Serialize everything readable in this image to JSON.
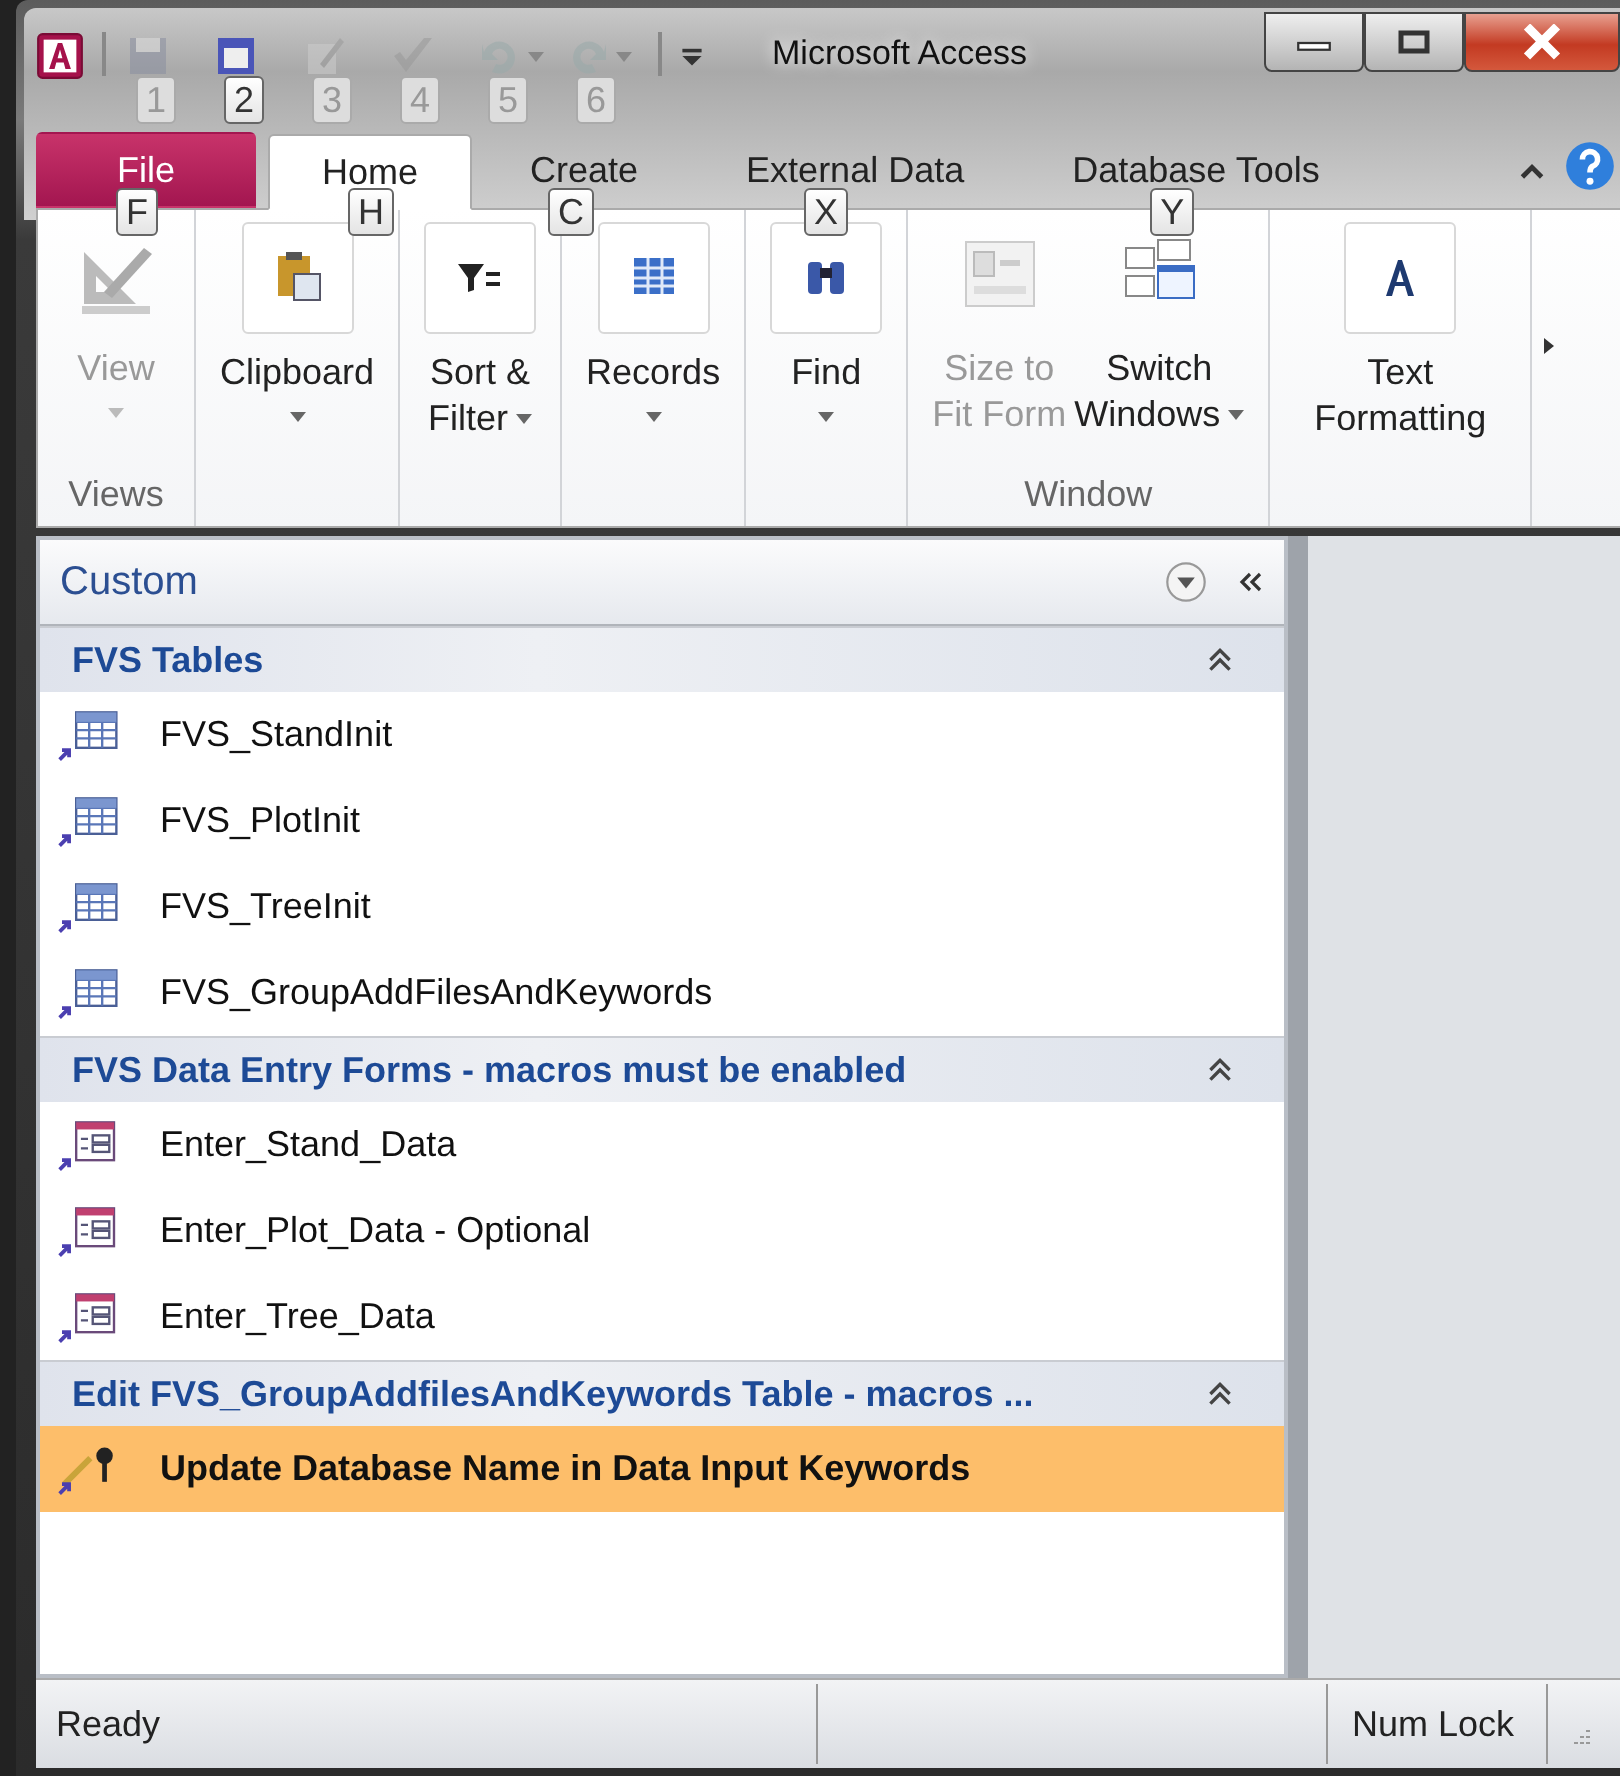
{
  "window": {
    "title": "Microsoft Access"
  },
  "quick_access": [
    {
      "kind": "save",
      "keytip": "1",
      "disabled": true
    },
    {
      "kind": "form",
      "keytip": "2",
      "disabled": false
    },
    {
      "kind": "edit",
      "keytip": "3",
      "disabled": true
    },
    {
      "kind": "check",
      "keytip": "4",
      "disabled": true
    },
    {
      "kind": "undo",
      "keytip": "5",
      "disabled": true
    },
    {
      "kind": "redo",
      "keytip": "6",
      "disabled": true
    }
  ],
  "tabs": [
    {
      "label": "File",
      "kind": "file",
      "selected": false,
      "keytip": "F"
    },
    {
      "label": "Home",
      "kind": "tab",
      "selected": true,
      "keytip": "H"
    },
    {
      "label": "Create",
      "kind": "tab",
      "selected": false,
      "keytip": "C"
    },
    {
      "label": "External Data",
      "kind": "tab",
      "selected": false,
      "keytip": "X"
    },
    {
      "label": "Database Tools",
      "kind": "tab",
      "selected": false,
      "keytip": "Y"
    }
  ],
  "ribbon": [
    {
      "label": "Views",
      "buttons": [
        {
          "kind": "view",
          "lines": [
            "View"
          ],
          "disabled": true,
          "dropdown": true
        }
      ]
    },
    {
      "buttons": [
        {
          "kind": "clipboard",
          "lines": [
            "Clipboard"
          ],
          "disabled": false,
          "dropdown": true
        }
      ]
    },
    {
      "buttons": [
        {
          "kind": "filter",
          "lines": [
            "Sort &",
            "Filter"
          ],
          "disabled": false,
          "dropdown": true
        }
      ]
    },
    {
      "buttons": [
        {
          "kind": "records",
          "lines": [
            "Records"
          ],
          "disabled": false,
          "dropdown": true
        }
      ]
    },
    {
      "buttons": [
        {
          "kind": "find",
          "lines": [
            "Find"
          ],
          "disabled": false,
          "dropdown": true
        }
      ]
    },
    {
      "label": "Window",
      "buttons": [
        {
          "kind": "fitform",
          "lines": [
            "Size to",
            "Fit Form"
          ],
          "disabled": true
        },
        {
          "kind": "windows",
          "lines": [
            "Switch",
            "Windows"
          ],
          "disabled": false,
          "dropdown": true
        }
      ]
    },
    {
      "buttons": [
        {
          "kind": "text",
          "lines": [
            "Text",
            "Formatting"
          ],
          "disabled": false
        }
      ]
    }
  ],
  "navigation": {
    "title": "Custom",
    "groups": [
      {
        "title": "FVS Tables",
        "items": [
          {
            "kind": "table",
            "label": "FVS_StandInit",
            "selected": false
          },
          {
            "kind": "table",
            "label": "FVS_PlotInit",
            "selected": false
          },
          {
            "kind": "table",
            "label": "FVS_TreeInit",
            "selected": false
          },
          {
            "kind": "table",
            "label": "FVS_GroupAddFilesAndKeywords",
            "selected": false
          }
        ]
      },
      {
        "title": "FVS Data Entry Forms - macros must be enabled",
        "items": [
          {
            "kind": "form",
            "label": "Enter_Stand_Data",
            "selected": false
          },
          {
            "kind": "form",
            "label": "Enter_Plot_Data - Optional",
            "selected": false
          },
          {
            "kind": "form",
            "label": "Enter_Tree_Data",
            "selected": false
          }
        ]
      },
      {
        "title": "Edit FVS_GroupAddfilesAndKeywords Table - macros ...",
        "items": [
          {
            "kind": "macro",
            "label": "Update Database Name in Data Input Keywords",
            "selected": true
          }
        ]
      }
    ]
  },
  "status_bar": {
    "message": "Ready",
    "indicators": [
      "Num Lock"
    ]
  }
}
